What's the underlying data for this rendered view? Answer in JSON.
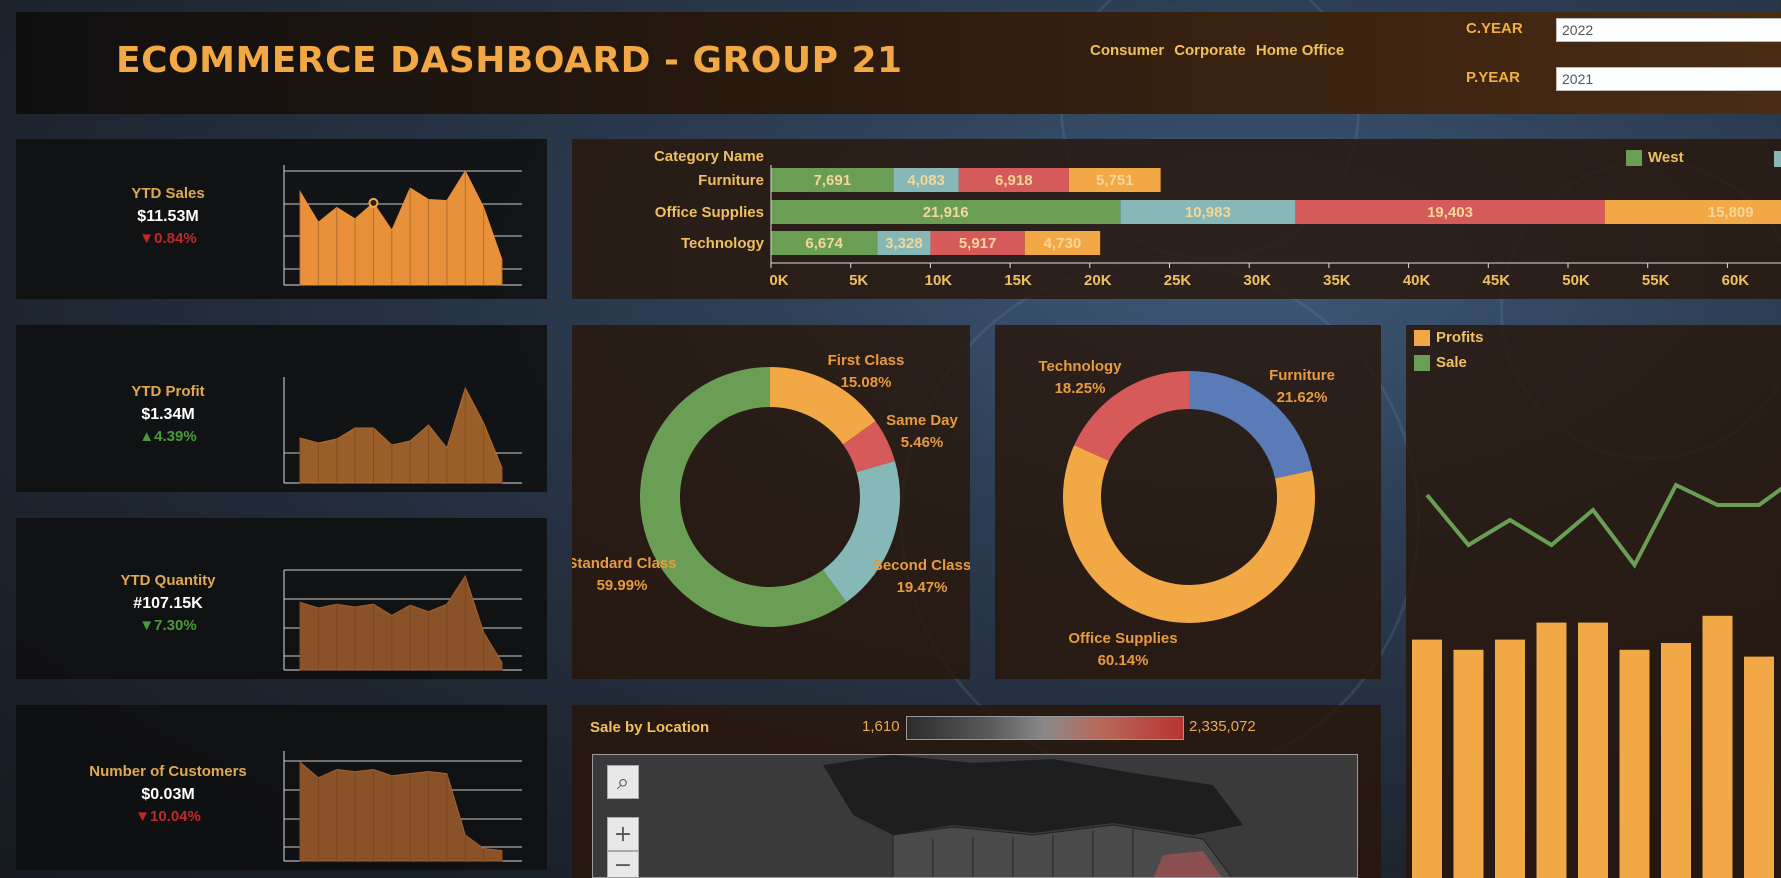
{
  "title": "ECOMMERCE DASHBOARD - GROUP 21",
  "segments": [
    "Consumer",
    "Corporate",
    "Home Office"
  ],
  "params": {
    "current_year_label": "C.YEAR",
    "current_year_value": "2022",
    "previous_year_label": "P.YEAR",
    "previous_year_value": "2021"
  },
  "kpis": [
    {
      "label": "YTD Sales",
      "value": "$11.53M",
      "delta": "▼0.84%",
      "delta_color": "#c0282a"
    },
    {
      "label": "YTD Profit",
      "value": "$1.34M",
      "delta": "▲4.39%",
      "delta_color": "#4a9a3a"
    },
    {
      "label": "YTD Quantity",
      "value": "#107.15K",
      "delta": "▼7.30%",
      "delta_color": "#4a9a3a"
    },
    {
      "label": "Number of Customers",
      "value": "$0.03M",
      "delta": "▼10.04%",
      "delta_color": "#c0282a"
    }
  ],
  "colors": {
    "orange": "#f2a845",
    "green": "#6a9e55",
    "teal": "#86b8b8",
    "red": "#d65a5a",
    "blue": "#5a7ab8",
    "text_gold": "#f0c060"
  },
  "chart_data": [
    {
      "type": "area",
      "id": "ytd_sales_trend",
      "values": [
        82,
        55,
        68,
        58,
        72,
        48,
        85,
        75,
        74,
        100,
        68,
        22
      ],
      "highlight_index": 4
    },
    {
      "type": "area",
      "id": "ytd_profit_trend",
      "values": [
        45,
        40,
        44,
        55,
        55,
        38,
        42,
        58,
        35,
        95,
        60,
        15
      ]
    },
    {
      "type": "area",
      "id": "ytd_quantity_trend",
      "values": [
        72,
        66,
        70,
        67,
        70,
        58,
        69,
        62,
        70,
        100,
        40,
        8
      ]
    },
    {
      "type": "area",
      "id": "customers_trend",
      "values": [
        95,
        80,
        88,
        86,
        88,
        82,
        84,
        86,
        84,
        25,
        12,
        10
      ]
    },
    {
      "type": "bar",
      "id": "category_by_region",
      "orientation": "horizontal",
      "stacked": true,
      "header": "Category Name",
      "categories": [
        "Furniture",
        "Office Supplies",
        "Technology"
      ],
      "series": [
        {
          "name": "West",
          "values": [
            7691,
            21916,
            6674
          ]
        },
        {
          "name": "",
          "values": [
            4083,
            10983,
            3328
          ]
        },
        {
          "name": "",
          "values": [
            6918,
            19403,
            5917
          ]
        },
        {
          "name": "",
          "values": [
            5751,
            15809,
            4730
          ]
        }
      ],
      "x_ticks": [
        "0K",
        "5K",
        "10K",
        "15K",
        "20K",
        "25K",
        "30K",
        "35K",
        "40K",
        "45K",
        "50K",
        "55K",
        "60K"
      ],
      "xlim": [
        0,
        65000
      ]
    },
    {
      "type": "pie",
      "id": "ship_mode_share",
      "donut": true,
      "slices": [
        {
          "label": "First Class",
          "pct": "15.08%",
          "value": 15.08
        },
        {
          "label": "Same Day",
          "pct": "5.46%",
          "value": 5.46
        },
        {
          "label": "Second Class",
          "pct": "19.47%",
          "value": 19.47
        },
        {
          "label": "Standard Class",
          "pct": "59.99%",
          "value": 59.99
        }
      ]
    },
    {
      "type": "pie",
      "id": "category_share",
      "donut": true,
      "slices": [
        {
          "label": "Furniture",
          "pct": "21.62%",
          "value": 21.62
        },
        {
          "label": "Office Supplies",
          "pct": "60.14%",
          "value": 60.14
        },
        {
          "label": "Technology",
          "pct": "18.25%",
          "value": 18.25
        }
      ]
    },
    {
      "type": "bar",
      "id": "profits_vs_sale",
      "legend": [
        "Profits",
        "Sale"
      ],
      "bar_values": [
        76,
        73,
        76,
        81,
        81,
        73,
        75,
        83,
        71
      ],
      "line_values": [
        62,
        52,
        57,
        52,
        59,
        48,
        64,
        60,
        60,
        66
      ]
    }
  ],
  "map": {
    "title": "Sale by Location",
    "legend_min": "1,610",
    "legend_max": "2,335,072"
  }
}
